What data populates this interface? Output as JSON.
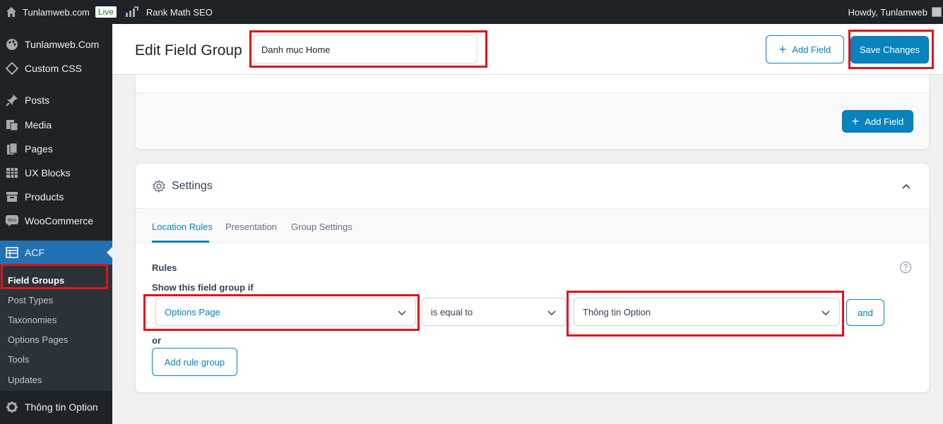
{
  "adminbar": {
    "site_name": "Tunlamweb.com",
    "live_badge": "Live",
    "rank_math": "Rank Math SEO",
    "howdy": "Howdy, Tunlamweb"
  },
  "sidebar": {
    "items": [
      {
        "label": "Tunlamweb.Com",
        "icon": "palette-icon"
      },
      {
        "label": "Custom CSS",
        "icon": "diamond-icon"
      },
      {
        "label": "Posts",
        "icon": "pin-icon"
      },
      {
        "label": "Media",
        "icon": "media-icon"
      },
      {
        "label": "Pages",
        "icon": "pages-icon"
      },
      {
        "label": "UX Blocks",
        "icon": "grid-icon"
      },
      {
        "label": "Products",
        "icon": "archive-icon"
      },
      {
        "label": "WooCommerce",
        "icon": "woo-icon"
      },
      {
        "label": "ACF",
        "icon": "table-icon"
      },
      {
        "label": "Thông tin Option",
        "icon": "gear-icon"
      }
    ],
    "submenu": [
      "Field Groups",
      "Post Types",
      "Taxonomies",
      "Options Pages",
      "Tools",
      "Updates"
    ]
  },
  "header": {
    "title": "Edit Field Group",
    "group_name": "Danh mục Home",
    "add_field": "Add Field",
    "save": "Save Changes"
  },
  "fields_panel": {
    "add_field": "Add Field"
  },
  "settings": {
    "title": "Settings",
    "tabs": [
      "Location Rules",
      "Presentation",
      "Group Settings"
    ],
    "rules_label": "Rules",
    "show_if": "Show this field group if",
    "param": "Options Page",
    "operator": "is equal to",
    "value": "Thông tin Option",
    "and_button": "and",
    "or_label": "or",
    "add_rule_group": "Add rule group"
  },
  "colors": {
    "accent": "#0783be",
    "highlight": "#e0131b",
    "admin_dark": "#1d2327",
    "menu_active": "#2271b1"
  }
}
